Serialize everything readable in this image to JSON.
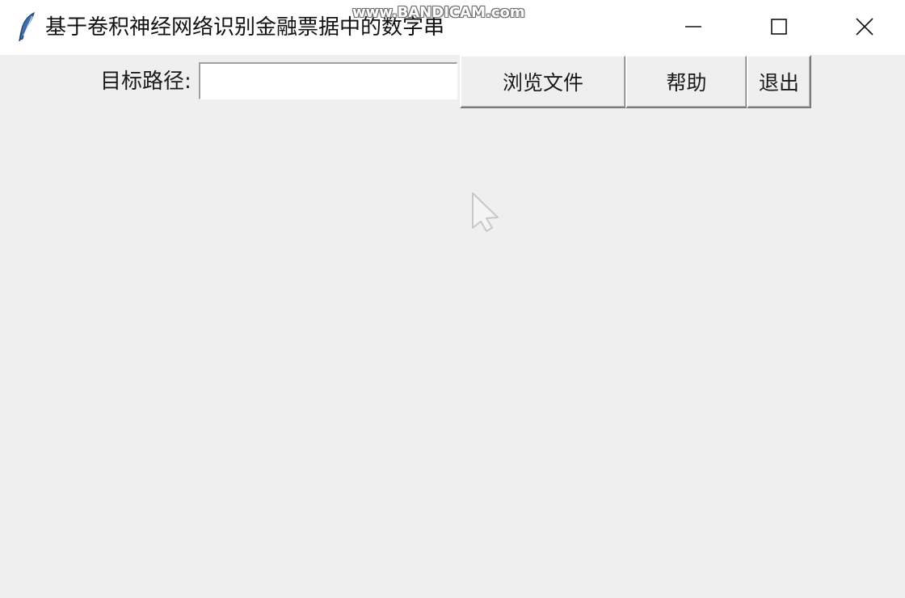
{
  "window": {
    "title": "基于卷积神经网络识别金融票据中的数字串",
    "icon": "feather-icon",
    "controls": {
      "minimize": "minimize-icon",
      "maximize": "maximize-icon",
      "close": "close-icon"
    }
  },
  "watermark": {
    "text": "www.BANDICAM.com"
  },
  "toolbar": {
    "path_label": "目标路径:",
    "path_value": "",
    "browse_label": "浏览文件",
    "help_label": "帮助",
    "exit_label": "退出"
  },
  "colors": {
    "background": "#efefef",
    "titlebar": "#ffffff"
  }
}
